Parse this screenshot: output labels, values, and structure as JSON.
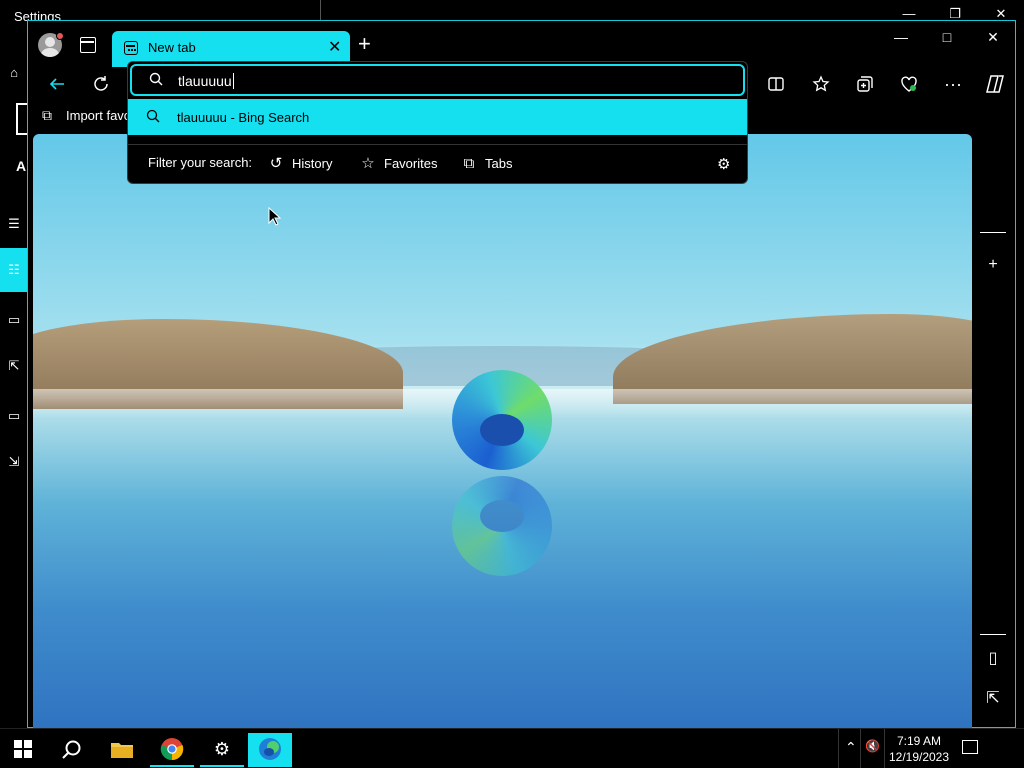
{
  "settings": {
    "title": "Settings",
    "minimize": "—",
    "maximize": "❐",
    "close": "✕",
    "nav_letter": "A"
  },
  "browser": {
    "tab": {
      "title": "New tab"
    },
    "window": {
      "minimize": "—",
      "maximize": "□",
      "close": "✕"
    },
    "import_favorites": "Import favo",
    "address_bar": {
      "value": "tlauuuuu"
    },
    "suggestion": {
      "text": "tlauuuuu - Bing Search"
    },
    "filter": {
      "label": "Filter your search:",
      "options": [
        "History",
        "Favorites",
        "Tabs"
      ]
    }
  },
  "taskbar": {
    "time": "7:19 AM",
    "date": "12/19/2023"
  },
  "colors": {
    "accent": "#14e0f0",
    "background": "#000000"
  },
  "icons": {
    "back": "arrow-left-icon",
    "refresh": "refresh-icon",
    "split": "split-screen-icon",
    "favorites": "star-icon",
    "collections": "collections-icon",
    "health": "browser-essentials-icon",
    "more": "more-icon",
    "copilot": "copilot-icon"
  }
}
